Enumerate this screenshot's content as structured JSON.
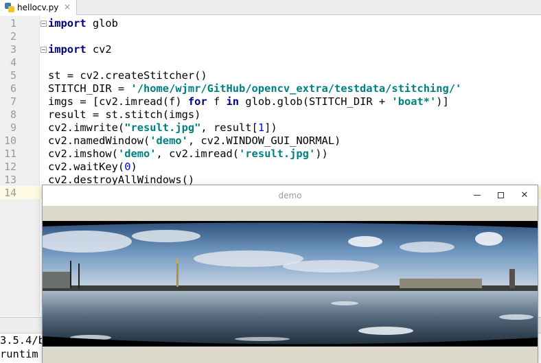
{
  "tab": {
    "filename": "hellocv.py",
    "close_glyph": "×"
  },
  "editor": {
    "line_numbers": [
      "1",
      "2",
      "3",
      "4",
      "5",
      "6",
      "7",
      "8",
      "9",
      "10",
      "11",
      "12",
      "13",
      "14"
    ]
  },
  "console": {
    "line1": "3.5.4/b",
    "line2": "runtim"
  },
  "demo_window": {
    "title": "demo",
    "close_glyph": "✕"
  },
  "colors": {
    "keyword": "#000080",
    "string": "#008080",
    "number": "#0000ff",
    "current_line": "#fffae3"
  }
}
